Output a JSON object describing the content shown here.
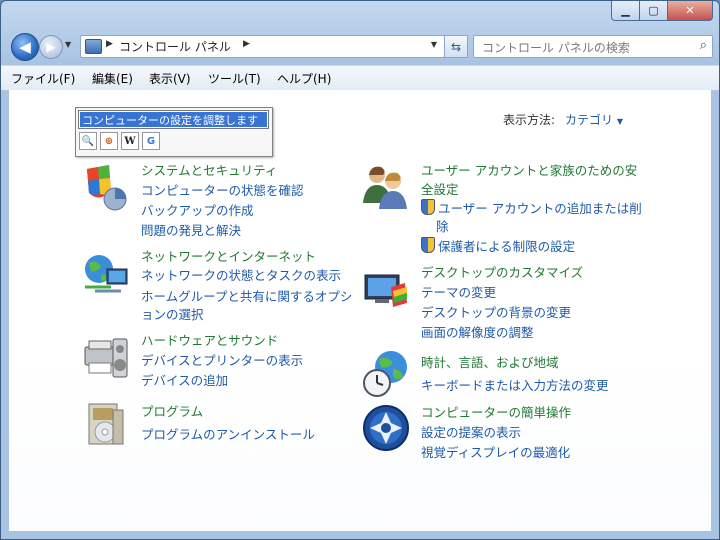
{
  "window": {
    "caption_buttons": {
      "minimize": "▁",
      "maximize": "▢",
      "close": "✕"
    }
  },
  "navbar": {
    "address_crumb": "コントロール パネル",
    "search_placeholder": "コントロール パネルの検索"
  },
  "menu": [
    "ファイル(F)",
    "編集(E)",
    "表示(V)",
    "ツール(T)",
    "ヘルプ(H)"
  ],
  "popup": {
    "selected_text": "コンピューターの設定を調整します",
    "tools": [
      "🔍",
      "⊕",
      "W",
      "G"
    ]
  },
  "view_by": {
    "label": "表示方法:",
    "value": "カテゴリ"
  },
  "left_categories": [
    {
      "title": "システムとセキュリティ",
      "links": [
        "コンピューターの状態を確認",
        "バックアップの作成",
        "問題の発見と解決"
      ]
    },
    {
      "title": "ネットワークとインターネット",
      "links": [
        "ネットワークの状態とタスクの表示",
        "ホームグループと共有に関するオプシ",
        "ョンの選択"
      ]
    },
    {
      "title": "ハードウェアとサウンド",
      "links": [
        "デバイスとプリンターの表示",
        "デバイスの追加"
      ]
    },
    {
      "title": "プログラム",
      "links": [
        "プログラムのアンインストール"
      ]
    }
  ],
  "right_categories": [
    {
      "title_line1": "ユーザー アカウントと家族のための安",
      "title_line2": "全設定",
      "links": [
        "ユーザー アカウントの追加または削",
        "除",
        "保護者による制限の設定"
      ]
    },
    {
      "title": "デスクトップのカスタマイズ",
      "links": [
        "テーマの変更",
        "デスクトップの背景の変更",
        "画面の解像度の調整"
      ]
    },
    {
      "title": "時計、言語、および地域",
      "links": [
        "キーボードまたは入力方法の変更"
      ]
    },
    {
      "title": "コンピューターの簡単操作",
      "links": [
        "設定の提案の表示",
        "視覚ディスプレイの最適化"
      ]
    }
  ]
}
